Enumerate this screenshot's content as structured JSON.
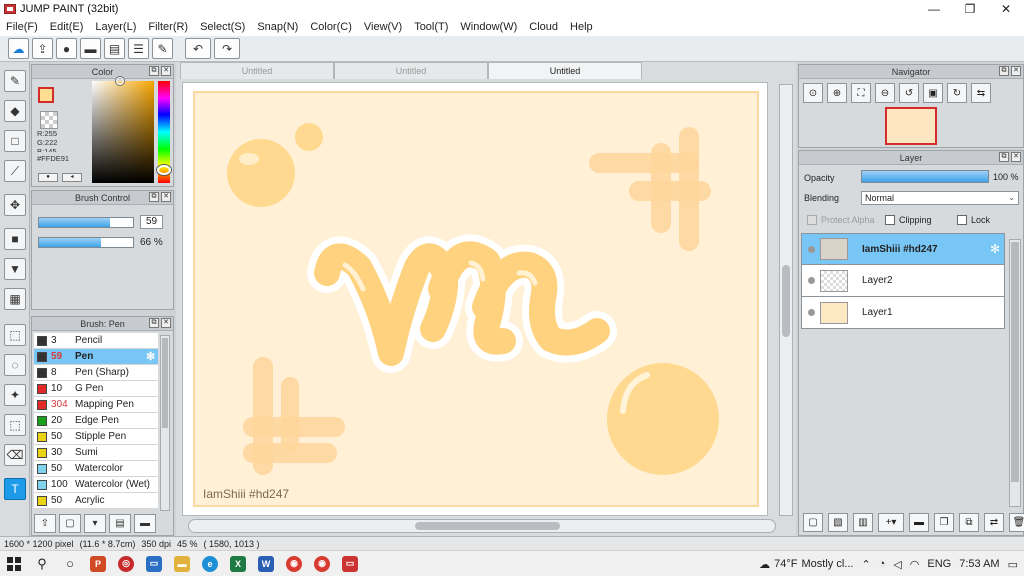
{
  "window": {
    "title": "JUMP PAINT (32bit)",
    "min": "—",
    "max": "❐",
    "close": "✕"
  },
  "menu": [
    "File(F)",
    "Edit(E)",
    "Layer(L)",
    "Filter(R)",
    "Select(S)",
    "Snap(N)",
    "Color(C)",
    "View(V)",
    "Tool(T)",
    "Window(W)",
    "Cloud",
    "Help"
  ],
  "toolbar_icons": [
    "cloud-icon",
    "share-icon",
    "speech-icon",
    "chat-icon",
    "document-icon",
    "list-icon",
    "edit-icon",
    "undo-icon",
    "redo-icon"
  ],
  "tools": [
    "brush-icon",
    "eraser-icon",
    "rectangle-icon",
    "line-icon",
    "move-icon",
    "fill-rect-icon",
    "bucket-icon",
    "gradient-icon",
    "select-rect-icon",
    "lasso-icon",
    "magic-wand-icon",
    "select-pen-icon",
    "select-eraser-icon",
    "text-icon"
  ],
  "color": {
    "title": "Color",
    "primary": "#FFDE91",
    "secondary": "#8FA2E3",
    "rgb_r": "R:255",
    "rgb_g": "G:222",
    "rgb_b": "B:145",
    "hex": "#FFDE91"
  },
  "brush_control": {
    "title": "Brush Control",
    "size_value": "59",
    "size_fraction": 0.75,
    "opacity_value": "66 %",
    "opacity_fraction": 0.66
  },
  "brush_list": {
    "title": "Brush: Pen",
    "items": [
      {
        "size": "3",
        "name": "Pencil",
        "color": "#333333",
        "red": false,
        "selected": false
      },
      {
        "size": "59",
        "name": "Pen",
        "color": "#333333",
        "red": true,
        "selected": true
      },
      {
        "size": "8",
        "name": "Pen (Sharp)",
        "color": "#333333",
        "red": false,
        "selected": false
      },
      {
        "size": "10",
        "name": "G Pen",
        "color": "#e02929",
        "red": false,
        "selected": false
      },
      {
        "size": "304",
        "name": "Mapping Pen",
        "color": "#e02929",
        "red": true,
        "selected": false
      },
      {
        "size": "20",
        "name": "Edge Pen",
        "color": "#1aa01a",
        "red": false,
        "selected": false
      },
      {
        "size": "50",
        "name": "Stipple Pen",
        "color": "#e8d414",
        "red": false,
        "selected": false
      },
      {
        "size": "30",
        "name": "Sumi",
        "color": "#e8d414",
        "red": false,
        "selected": false
      },
      {
        "size": "50",
        "name": "Watercolor",
        "color": "#7fd3ee",
        "red": false,
        "selected": false
      },
      {
        "size": "100",
        "name": "Watercolor (Wet)",
        "color": "#7fd3ee",
        "red": false,
        "selected": false
      },
      {
        "size": "50",
        "name": "Acrylic",
        "color": "#e8d414",
        "red": false,
        "selected": false
      }
    ]
  },
  "tabs": [
    "Untitled",
    "Untitled",
    "Untitled"
  ],
  "canvas": {
    "watermark": "IamShiii #hd247",
    "accent": "#FFDE91",
    "background": "#FFF0D6"
  },
  "navigator": {
    "title": "Navigator"
  },
  "layer_panel": {
    "title": "Layer",
    "opacity_label": "Opacity",
    "opacity_value": "100 %",
    "blending_label": "Blending",
    "blending_value": "Normal",
    "protect_alpha": "Protect Alpha",
    "clipping": "Clipping",
    "lock": "Lock",
    "layers": [
      {
        "name": "IamShiii #hd247",
        "selected": true
      },
      {
        "name": "Layer2",
        "selected": false
      },
      {
        "name": "Layer1",
        "selected": false
      }
    ]
  },
  "status": {
    "size": "1600 * 1200 pixel",
    "cm": "(11.6 * 8.7cm)",
    "dpi": "350 dpi",
    "zoom": "45 %",
    "coords": "( 1580, 1013 )"
  },
  "taskbar": {
    "temp": "74°F",
    "weather": "Mostly cl...",
    "lang": "ENG",
    "time": "7:53 AM"
  }
}
